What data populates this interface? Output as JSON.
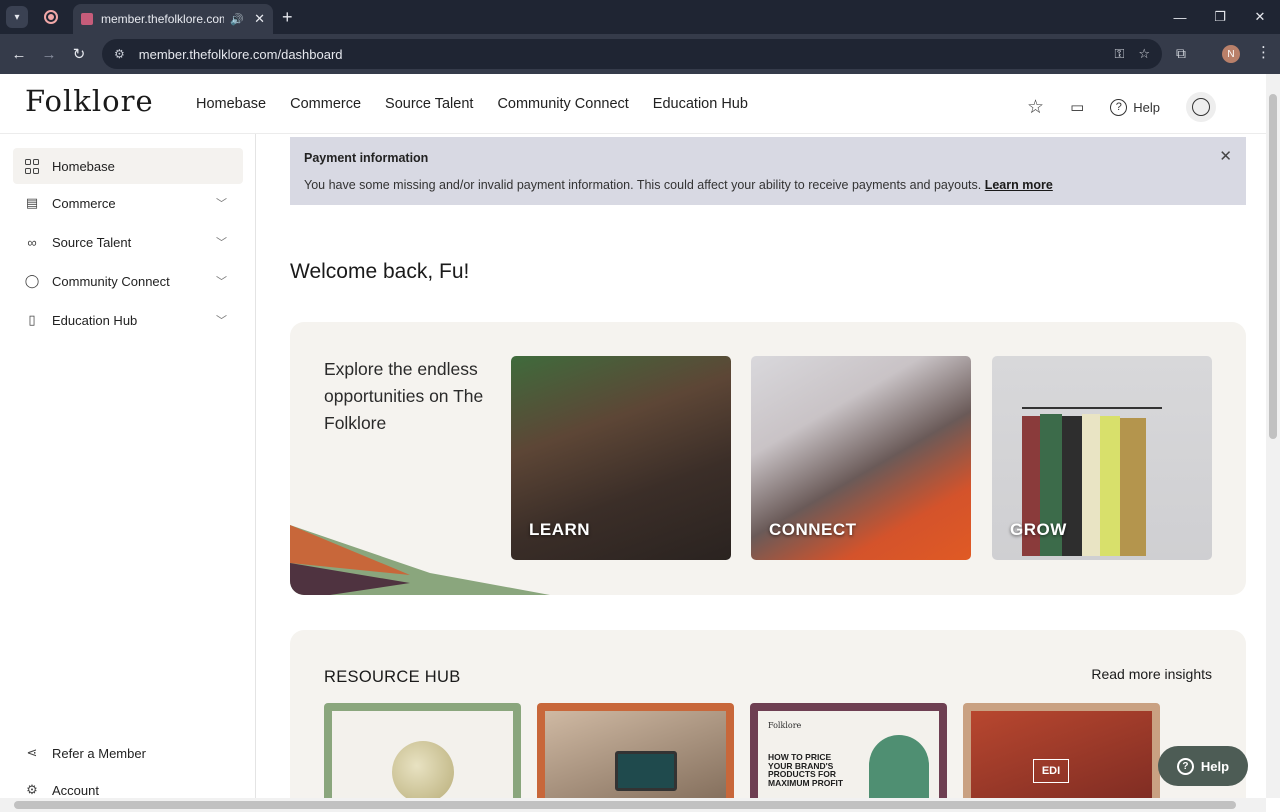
{
  "browser": {
    "tab_title": "member.thefolklore.com/dashboard",
    "url": "member.thefolklore.com/dashboard",
    "profile_initial": "N",
    "new_tab_glyph": "+"
  },
  "header": {
    "logo": "Folklore",
    "nav": [
      "Homebase",
      "Commerce",
      "Source Talent",
      "Community Connect",
      "Education Hub"
    ],
    "help_label": "Help"
  },
  "sidebar": {
    "items": [
      {
        "label": "Homebase",
        "icon": "grid-icon",
        "active": true
      },
      {
        "label": "Commerce",
        "icon": "store-icon"
      },
      {
        "label": "Source Talent",
        "icon": "binoculars-icon"
      },
      {
        "label": "Community Connect",
        "icon": "chat-bubble-icon"
      },
      {
        "label": "Education Hub",
        "icon": "document-icon"
      }
    ],
    "bottom": [
      {
        "label": "Refer a Member",
        "icon": "share-icon"
      },
      {
        "label": "Account",
        "icon": "gear-icon"
      }
    ]
  },
  "alert": {
    "title": "Payment information",
    "text": "You have some missing and/or invalid payment information. This could affect your ability to receive payments and payouts.",
    "link": "Learn more"
  },
  "main": {
    "welcome": "Welcome back, Fu!",
    "explore_text": "Explore the endless opportunities on The Folklore",
    "cards": [
      "LEARN",
      "CONNECT",
      "GROW"
    ],
    "resource_title": "RESOURCE HUB",
    "read_more": "Read more insights",
    "resource_card_3": {
      "brand": "Folklore",
      "headline": "HOW TO PRICE YOUR BRAND'S PRODUCTS FOR MAXIMUM PROFIT"
    },
    "resource_card_4_tag": "EDI"
  },
  "help_fab": "Help",
  "colors": {
    "chrome_dark": "#1f2533",
    "chrome_mid": "#353b4a",
    "alert_bg": "#d8d9e3",
    "panel_bg": "#f5f3ef",
    "help_fab_bg": "#4d5c55"
  }
}
